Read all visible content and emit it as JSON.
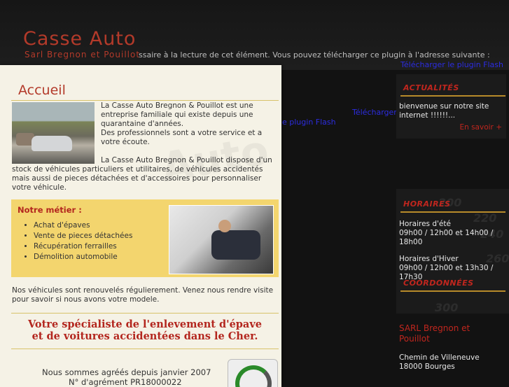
{
  "header": {
    "logo_title": "Casse Auto",
    "logo_subtitle": "Sarl Bregnon et Pouillot",
    "flash_message": "ssaire à la lecture de cet élément. Vous pouvez télécharger ce plugin à l'adresse suivante :",
    "flash_link": "Télécharger le plugin Flash",
    "ghost_link_1": "Télécharger",
    "ghost_link_2": "e plugin Flash"
  },
  "main": {
    "title": "Accueil",
    "intro_p1": "La Casse Auto Bregnon & Pouillot est une entreprise familiale qui existe depuis une quarantaine d'années.",
    "intro_p2": "Des professionnels sont a votre service et a votre écoute.",
    "intro_p3": "La Casse Auto Bregnon & Pouillot dispose d'un stock de véhicules particuliers et utilitaires, de véhicules accidentés mais aussi de pieces détachées et d'accessoires pour personnaliser votre véhicule.",
    "metier_title": "Notre métier :",
    "metier_items": [
      "Achat d'épaves",
      "Vente de pieces détachées",
      "Récupération ferrailles",
      "Démolition automobile"
    ],
    "renew_text": "Nos véhicules sont renouvelés régulierement. Venez nous rendre visite pour savoir si nous avons votre modele.",
    "slogan_line1": "Votre spécialiste de l'enlevement d'épave",
    "slogan_line2": "et de voitures accidentées dans le Cher.",
    "agree_line1": "Nous sommes agréés depuis janvier 2007",
    "agree_line2": "N° d'agrément PR18000022"
  },
  "sidebar": {
    "news_title": "ACTUALITÉS",
    "news_text": "bienvenue sur notre site internet !!!!!!...",
    "news_more": "En savoir +",
    "hours_title": "HORAIRES",
    "hours_summer_label": "Horaires d'été",
    "hours_summer": "09h00 / 12h00 et 14h00 / 18h00",
    "hours_winter_label": "Horaires d'Hiver",
    "hours_winter": "09h00 / 12h00 et 13h30 / 17h30",
    "contact_title": "COORDONNÉES",
    "company": "SARL Bregnon et Pouillot",
    "street": "Chemin de Villeneuve",
    "city": "18000 Bourges"
  },
  "colors": {
    "accent": "#b33a2a",
    "highlight": "#f3d56e",
    "panel": "#f5f2e6",
    "background": "#121212"
  }
}
